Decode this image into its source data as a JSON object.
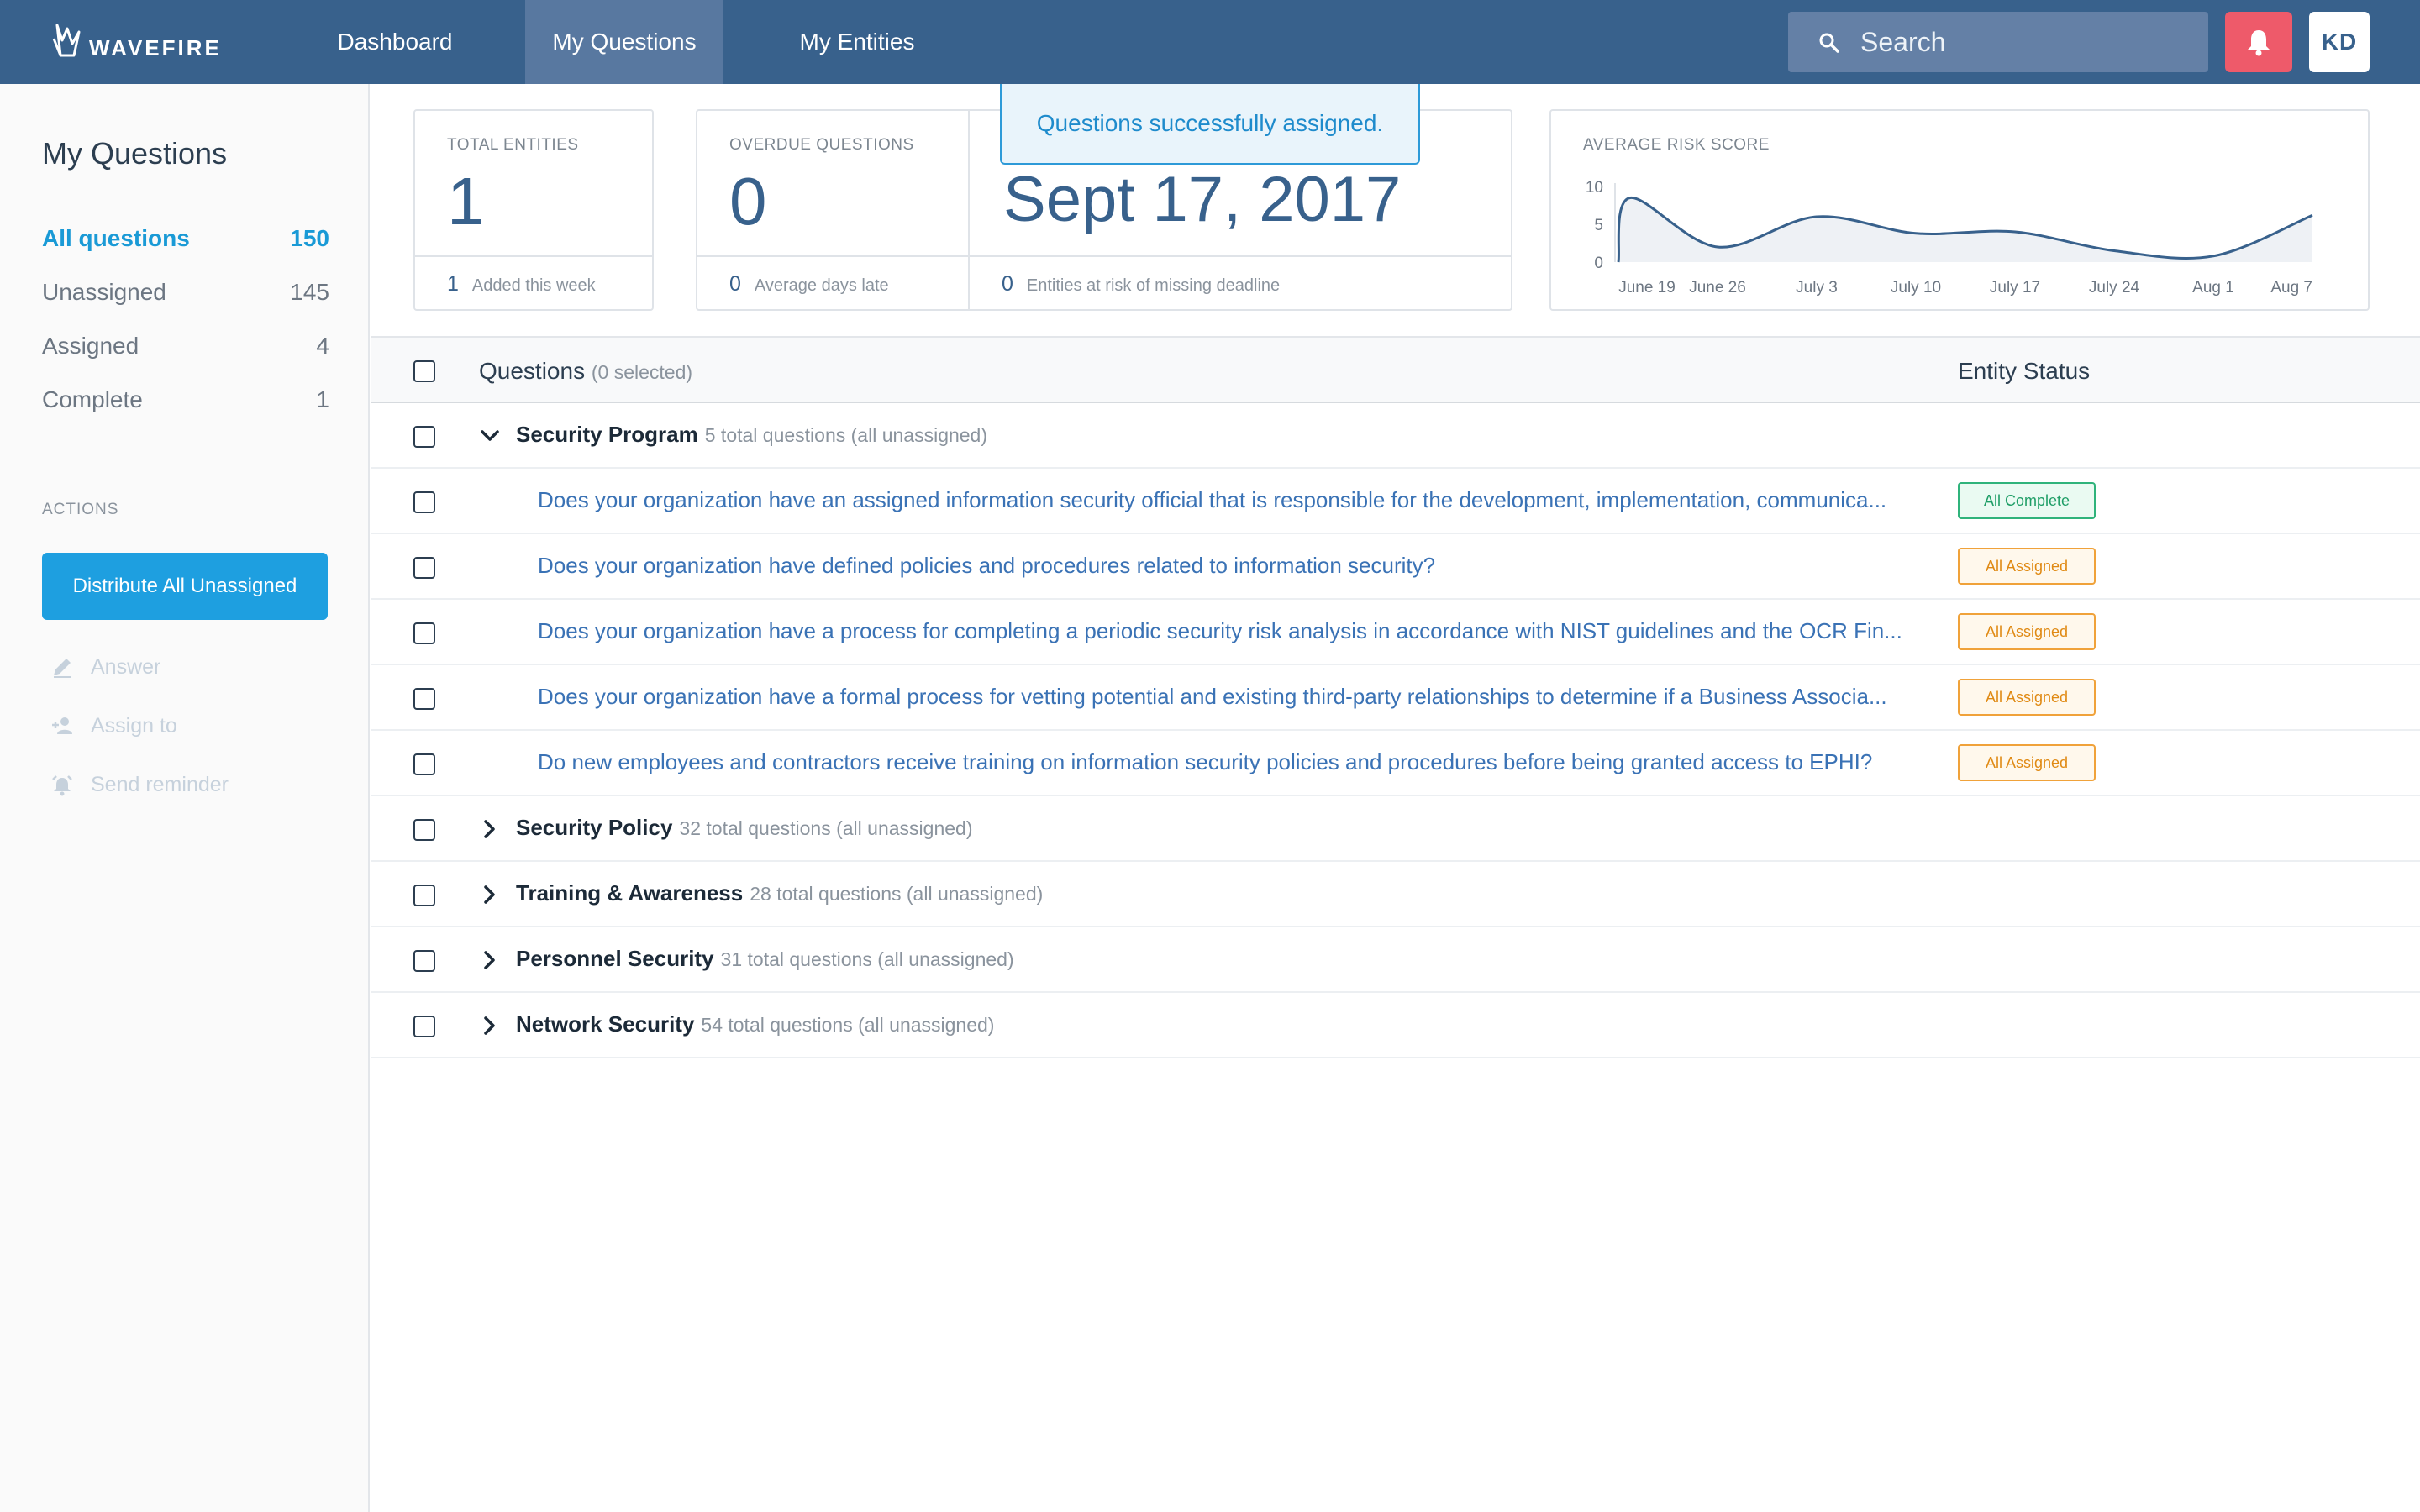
{
  "app": {
    "logo_text": "WAVEFIRE",
    "nav": [
      {
        "label": "Dashboard"
      },
      {
        "label": "My Questions"
      },
      {
        "label": "My Entities"
      }
    ],
    "search_placeholder": "Search",
    "user_initials": "KD"
  },
  "sidebar": {
    "title": "My Questions",
    "filters": [
      {
        "label": "All questions",
        "count": "150"
      },
      {
        "label": "Unassigned",
        "count": "145"
      },
      {
        "label": "Assigned",
        "count": "4"
      },
      {
        "label": "Complete",
        "count": "1"
      }
    ],
    "actions_label": "ACTIONS",
    "distribute_label": "Distribute All Unassigned",
    "answer_label": "Answer",
    "assign_label": "Assign to",
    "reminder_label": "Send reminder"
  },
  "toast": "Questions successfully assigned.",
  "stats": {
    "total_entities": {
      "label": "TOTAL ENTITIES",
      "value": "1",
      "foot_num": "1",
      "foot_text": "Added this week"
    },
    "overdue": {
      "label": "OVERDUE QUESTIONS",
      "value": "0",
      "foot_num": "0",
      "foot_text": "Average days late"
    },
    "deadline": {
      "value": "Sept 17, 2017",
      "foot_num": "0",
      "foot_text": "Entities at risk of missing deadline"
    },
    "risk": {
      "label": "AVERAGE RISK SCORE"
    }
  },
  "chart_data": {
    "type": "area",
    "title": "AVERAGE RISK SCORE",
    "x": [
      "June 19",
      "June 26",
      "July 3",
      "July 10",
      "July 17",
      "July 24",
      "Aug 1",
      "Aug 7"
    ],
    "yticks": [
      0,
      5,
      10
    ],
    "ylim": [
      0,
      10
    ],
    "series": [
      {
        "values": [
          8.5,
          2.0,
          6.0,
          3.8,
          4.0,
          1.5,
          0.8,
          6.2
        ]
      }
    ],
    "colors": {
      "line": "#38618c",
      "fill": "#eef1f5"
    },
    "grid": false
  },
  "table": {
    "header_label": "Questions",
    "header_selected": "(0 selected)",
    "status_header": "Entity Status",
    "groups": [
      {
        "name": "Security Program",
        "meta": "5 total questions (all unassigned)",
        "expanded": true,
        "questions": [
          {
            "text": "Does your organization have an assigned information security official that is responsible for the development, implementation, communica...",
            "status": "All Complete"
          },
          {
            "text": "Does your organization have defined policies and procedures related to information security?",
            "status": "All Assigned"
          },
          {
            "text": "Does your organization have a process for completing a periodic security risk analysis in accordance with NIST guidelines and the OCR Fin...",
            "status": "All Assigned"
          },
          {
            "text": "Does your organization have a formal process for vetting potential and existing third-party relationships to determine if a Business Associa...",
            "status": "All Assigned"
          },
          {
            "text": "Do new employees and contractors receive training on information security policies and procedures before being granted access to EPHI?",
            "status": "All Assigned"
          }
        ]
      },
      {
        "name": "Security Policy",
        "meta": "32 total questions (all unassigned)",
        "expanded": false
      },
      {
        "name": "Training & Awareness",
        "meta": "28 total questions (all unassigned)",
        "expanded": false
      },
      {
        "name": "Personnel Security",
        "meta": "31 total questions (all unassigned)",
        "expanded": false
      },
      {
        "name": "Network Security",
        "meta": "54 total questions (all unassigned)",
        "expanded": false
      }
    ]
  }
}
